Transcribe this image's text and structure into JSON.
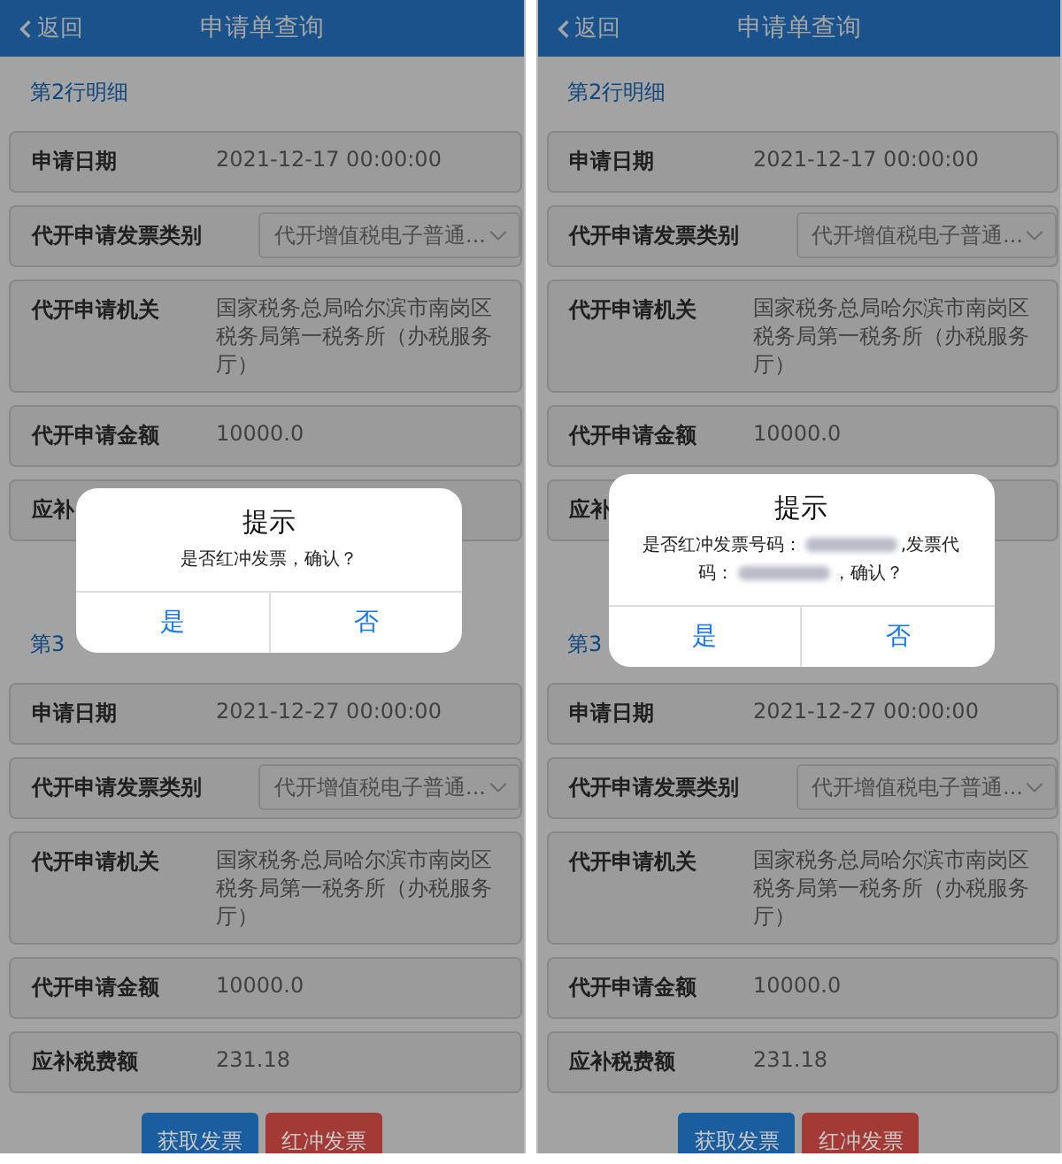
{
  "screens": [
    {
      "nav": {
        "back": "返回",
        "title": "申请单查询"
      },
      "sections": [
        {
          "title": "第2行明细",
          "rows": [
            {
              "kind": "text",
              "label": "申请日期",
              "value": "2021-12-17 00:00:00"
            },
            {
              "kind": "select",
              "label": "代开申请发票类别",
              "value": "代开增值税电子普通..."
            },
            {
              "kind": "text",
              "label": "代开申请机关",
              "value": "国家税务总局哈尔滨市南岗区税务局第一税务所（办税服务厅）"
            },
            {
              "kind": "text",
              "label": "代开申请金额",
              "value": "10000.0"
            },
            {
              "kind": "text",
              "label": "应补"
            }
          ]
        },
        {
          "title": "第3",
          "rows": [
            {
              "kind": "text",
              "label": "申请日期",
              "value": "2021-12-27 00:00:00"
            },
            {
              "kind": "select",
              "label": "代开申请发票类别",
              "value": "代开增值税电子普通..."
            },
            {
              "kind": "text",
              "label": "代开申请机关",
              "value": "国家税务总局哈尔滨市南岗区税务局第一税务所（办税服务厅）"
            },
            {
              "kind": "text",
              "label": "代开申请金额",
              "value": "10000.0"
            },
            {
              "kind": "text",
              "label": "应补税费额",
              "value": "231.18"
            }
          ],
          "buttons": [
            {
              "label": "获取发票",
              "color": "#1b5e9f"
            },
            {
              "label": "红冲发票",
              "color": "#a33a36"
            }
          ]
        }
      ],
      "dialog": {
        "title": "提示",
        "message": [
          {
            "kind": "text",
            "text": "是否红冲发票，确认？"
          }
        ],
        "buttons": [
          {
            "label": "是"
          },
          {
            "label": "否"
          }
        ]
      }
    },
    {
      "nav": {
        "back": "返回",
        "title": "申请单查询"
      },
      "sections": [
        {
          "title": "第2行明细",
          "rows": [
            {
              "kind": "text",
              "label": "申请日期",
              "value": "2021-12-17 00:00:00"
            },
            {
              "kind": "select",
              "label": "代开申请发票类别",
              "value": "代开增值税电子普通..."
            },
            {
              "kind": "text",
              "label": "代开申请机关",
              "value": "国家税务总局哈尔滨市南岗区税务局第一税务所（办税服务厅）"
            },
            {
              "kind": "text",
              "label": "代开申请金额",
              "value": "10000.0"
            },
            {
              "kind": "text",
              "label": "应补"
            }
          ]
        },
        {
          "title": "第3",
          "rows": [
            {
              "kind": "text",
              "label": "申请日期",
              "value": "2021-12-27 00:00:00"
            },
            {
              "kind": "select",
              "label": "代开申请发票类别",
              "value": "代开增值税电子普通..."
            },
            {
              "kind": "text",
              "label": "代开申请机关",
              "value": "国家税务总局哈尔滨市南岗区税务局第一税务所（办税服务厅）"
            },
            {
              "kind": "text",
              "label": "代开申请金额",
              "value": "10000.0"
            },
            {
              "kind": "text",
              "label": "应补税费额",
              "value": "231.18"
            }
          ],
          "buttons": [
            {
              "label": "获取发票",
              "color": "#1b5e9f"
            },
            {
              "label": "红冲发票",
              "color": "#a33a36"
            }
          ]
        }
      ],
      "dialog": {
        "title": "提示",
        "message": [
          {
            "kind": "text",
            "text": "是否红冲发票号码："
          },
          {
            "kind": "redacted"
          },
          {
            "kind": "text",
            "text": ",发票代码："
          },
          {
            "kind": "redacted"
          },
          {
            "kind": "text",
            "text": "，确认？"
          }
        ],
        "buttons": [
          {
            "label": "是"
          },
          {
            "label": "否"
          }
        ]
      }
    }
  ]
}
